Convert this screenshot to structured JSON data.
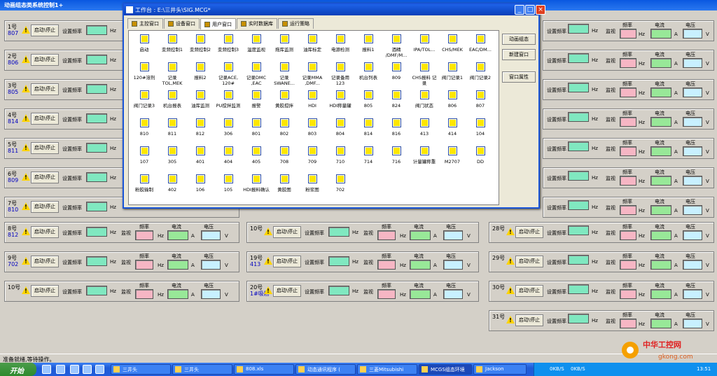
{
  "app_title": "动画组态类系统控制1+",
  "start_stop_label": "启动\\停止",
  "labels": {
    "set_freq": "设置频率",
    "hz": "Hz",
    "monitor": "监视",
    "freq": "频率",
    "current": "电流",
    "voltage": "电压",
    "a": "A",
    "v": "V"
  },
  "units_left": [
    {
      "id": "1号",
      "sub": "807"
    },
    {
      "id": "2号",
      "sub": "806"
    },
    {
      "id": "3号",
      "sub": "805"
    },
    {
      "id": "4号",
      "sub": "814"
    },
    {
      "id": "5号",
      "sub": "811"
    },
    {
      "id": "6号",
      "sub": "809"
    },
    {
      "id": "7号",
      "sub": "810"
    },
    {
      "id": "8号",
      "sub": "812"
    },
    {
      "id": "9号",
      "sub": "702"
    },
    {
      "id": "10号",
      "sub": ""
    }
  ],
  "units_mid": [
    {
      "id": "10号",
      "sub": ""
    },
    {
      "id": "19号",
      "sub": "413"
    },
    {
      "id": "20号",
      "sub": "1#吸粉"
    }
  ],
  "units_right": [
    {
      "id": "28号"
    },
    {
      "id": "29号"
    },
    {
      "id": "30号"
    },
    {
      "id": "31号"
    }
  ],
  "window": {
    "title": "工作台 : E:\\三井头\\SIG.MCG*",
    "min": "_",
    "max": "□",
    "close": "×",
    "tabs": [
      {
        "label": "主控窗口"
      },
      {
        "label": "设备窗口"
      },
      {
        "label": "用户窗口"
      },
      {
        "label": "实时数据库"
      },
      {
        "label": "运行策略"
      }
    ],
    "side_buttons": [
      "动画组态",
      "新建窗口",
      "窗口属性"
    ],
    "icons": [
      "启动",
      "变频控制1",
      "变频控制2",
      "变频控制3",
      "温度监视",
      "拖库监测",
      "油库标定",
      "电源检测",
      "报料1",
      "酒精 /DMF/M...",
      "IPA/TOL...",
      "CHS/MEK",
      "EAC/DM...",
      "120#溶剂",
      "记录 TOL,MEK",
      "报料2",
      "记录ACE, 120#",
      "记录DMC ,EAC",
      "记录 SWANE...",
      "记录MMA ,DMF...",
      "记录备用 123",
      "机台列表",
      "809",
      "CHS报料 记录",
      "阀门记录1",
      "阀门记录2",
      "阀门记录3",
      "机台报表",
      "油库监测",
      "PU搅拌监测",
      "报警",
      "黄胶搅拌",
      "HDI",
      "HDI称量罐",
      "805",
      "824",
      "阀门状态",
      "806",
      "807",
      "810",
      "811",
      "812",
      "306",
      "801",
      "802",
      "803",
      "804",
      "814",
      "816",
      "413",
      "414",
      "104",
      "107",
      "305",
      "401",
      "404",
      "405",
      "708",
      "709",
      "710",
      "714",
      "716",
      "计量罐称重",
      "M2707",
      "DD",
      "粉胶输制",
      "402",
      "106",
      "105",
      "HDI报料确认",
      "黄胶图",
      "粉浆图",
      "702"
    ]
  },
  "status": "准备就绪,等待操作。",
  "taskbar": {
    "start": "开始",
    "tasks": [
      "三井头",
      "三井头",
      "808.xls",
      "动态通讯程序 (",
      "三菱Mitsubishi",
      "MCGS组态环境",
      "Jackson"
    ],
    "tray_text": [
      "0KB/S",
      "0KB/S"
    ],
    "clock": "13:51"
  },
  "watermark": {
    "text": "中华工控网",
    "url": "gkong.com"
  }
}
